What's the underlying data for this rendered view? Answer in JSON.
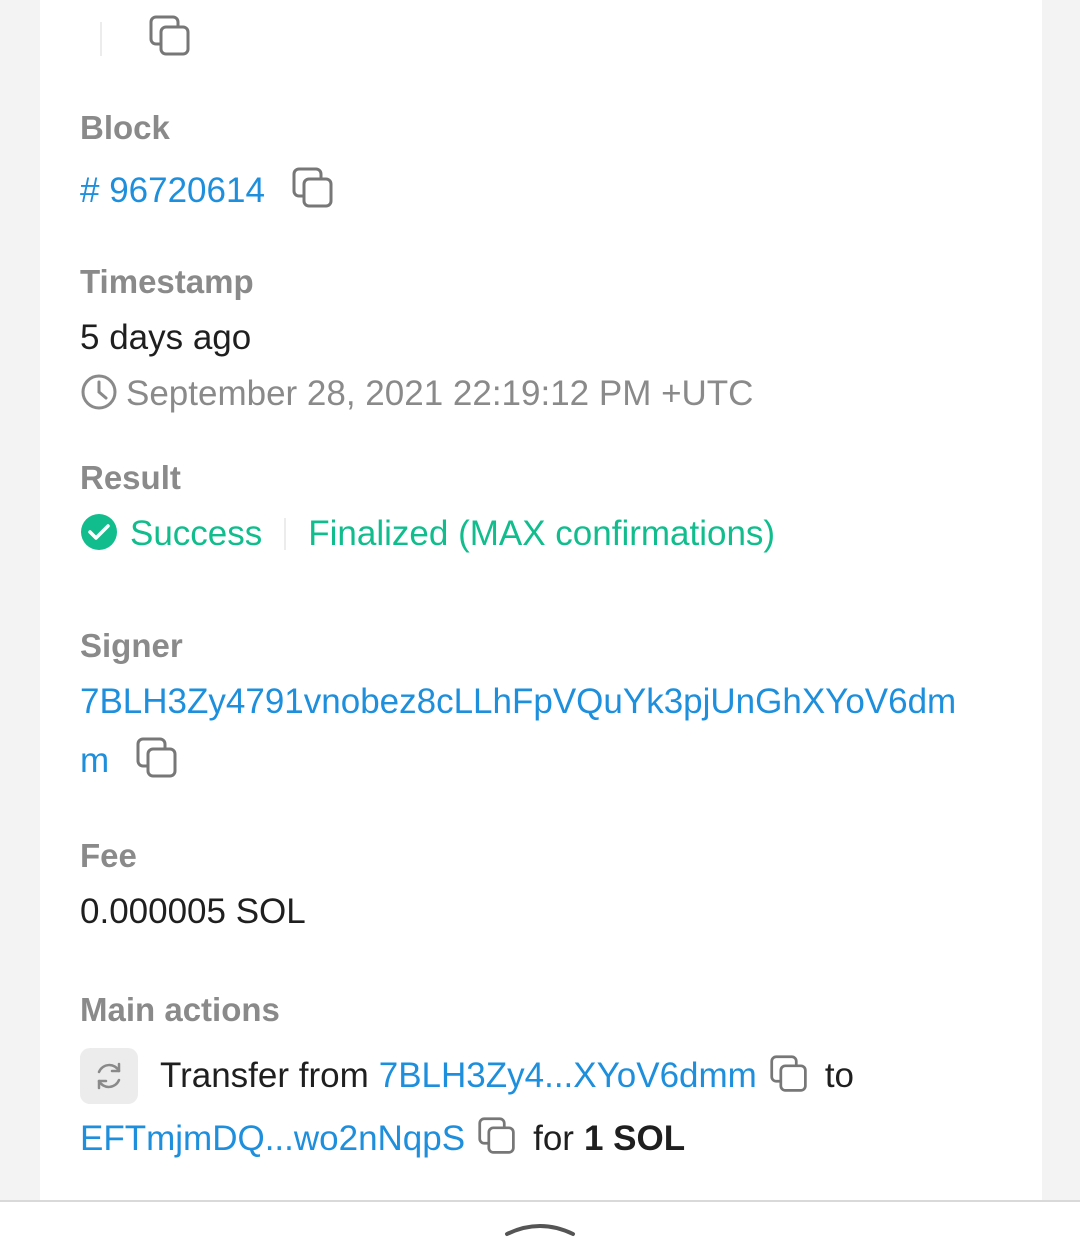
{
  "block": {
    "label": "Block",
    "value": "# 96720614"
  },
  "timestamp": {
    "label": "Timestamp",
    "relative": "5 days ago",
    "absolute": "September 28, 2021 22:19:12 PM +UTC"
  },
  "result": {
    "label": "Result",
    "status": "Success",
    "confirmation": "Finalized (MAX confirmations)"
  },
  "signer": {
    "label": "Signer",
    "line1": "7BLH3Zy4791vnobez8cLLhFpVQuYk3pjUnGhXYoV6dm",
    "line2": "m"
  },
  "fee": {
    "label": "Fee",
    "value": "0.000005 SOL"
  },
  "main_actions": {
    "label": "Main actions",
    "transfer_prefix": "Transfer from",
    "from_address": "7BLH3Zy4...XYoV6dmm",
    "to_word": "to",
    "to_address": "EFTmjmDQ...wo2nNqpS",
    "for_word": "for",
    "amount": "1 SOL"
  },
  "colors": {
    "link": "#1e8fdc",
    "success": "#12bd8d",
    "label": "#8a8a8a",
    "text": "#1f1f1f"
  },
  "icons": [
    "copy-icon",
    "clock-icon",
    "check-circle-icon",
    "refresh-icon",
    "chevron-up-icon"
  ]
}
